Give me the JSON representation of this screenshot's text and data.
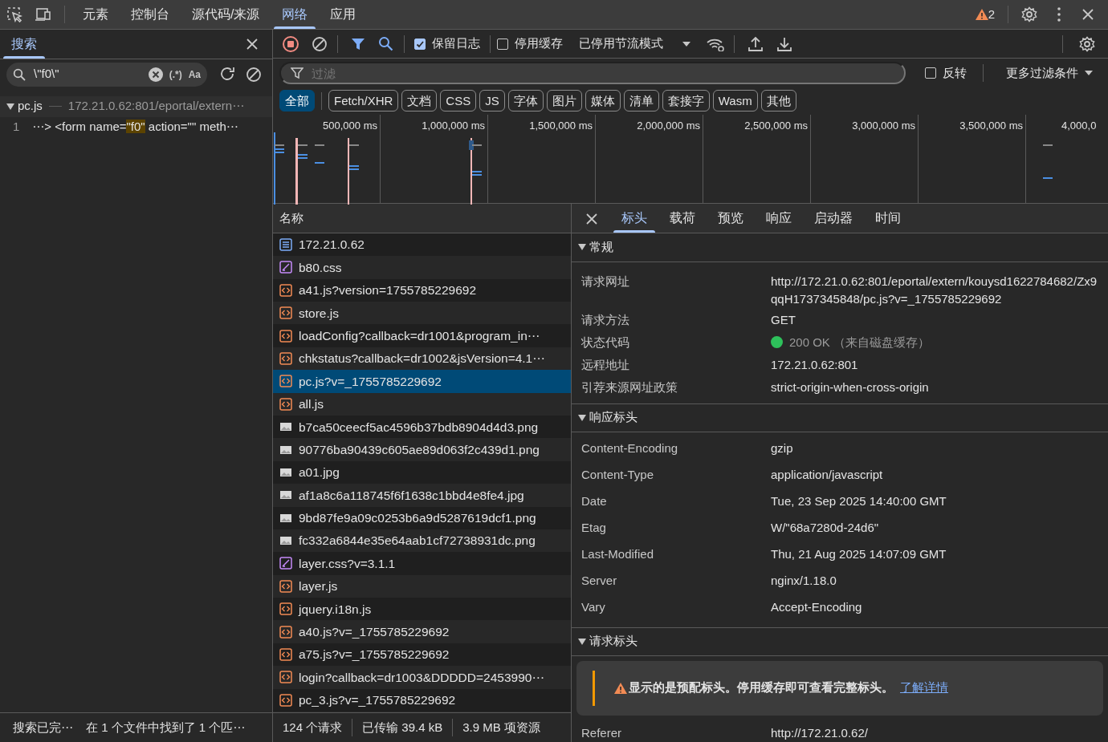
{
  "top_tabs": [
    {
      "label": "元素",
      "selected": false
    },
    {
      "label": "控制台",
      "selected": false
    },
    {
      "label": "源代码/来源",
      "selected": false
    },
    {
      "label": "网络",
      "selected": true
    },
    {
      "label": "应用",
      "selected": false
    }
  ],
  "issues_count": "2",
  "search_panel": {
    "tab": "搜索",
    "query": "\\\"f0\\\"",
    "regex_toggle": "(.*)",
    "case_toggle": "Aa",
    "results": [
      {
        "file": "pc.js",
        "path": "172.21.0.62:801/eportal/extern⋯",
        "expanded": true,
        "matches": [
          {
            "line": "1",
            "before": "⋯> <form name=",
            "match": "\"f0\"",
            "after": " action=\"\" meth⋯"
          }
        ]
      }
    ],
    "status": [
      "搜索已完⋯",
      "在 1 个文件中找到了 1 个匹⋯"
    ]
  },
  "network_toolbar": {
    "preserve_log": {
      "label": "保留日志",
      "checked": true
    },
    "disable_cache": {
      "label": "停用缓存",
      "checked": false
    },
    "throttling": "已停用节流模式"
  },
  "filter": {
    "placeholder": "过滤",
    "invert": {
      "label": "反转",
      "checked": false
    },
    "more_filters": "更多过滤条件"
  },
  "type_filters": [
    {
      "label": "全部",
      "selected": true
    },
    {
      "label": "Fetch/XHR",
      "selected": false
    },
    {
      "label": "文档",
      "selected": false
    },
    {
      "label": "CSS",
      "selected": false
    },
    {
      "label": "JS",
      "selected": false
    },
    {
      "label": "字体",
      "selected": false
    },
    {
      "label": "图片",
      "selected": false
    },
    {
      "label": "媒体",
      "selected": false
    },
    {
      "label": "清单",
      "selected": false
    },
    {
      "label": "套接字",
      "selected": false
    },
    {
      "label": "Wasm",
      "selected": false
    },
    {
      "label": "其他",
      "selected": false
    }
  ],
  "overview": {
    "ticks": [
      "500,000 ms",
      "1,000,000 ms",
      "1,500,000 ms",
      "2,000,000 ms",
      "2,500,000 ms",
      "3,000,000 ms",
      "3,500,000 ms",
      "4,000,0"
    ]
  },
  "requests": {
    "column": "名称",
    "rows": [
      {
        "name": "172.21.0.62",
        "kind": "doc",
        "selected": false
      },
      {
        "name": "b80.css",
        "kind": "css",
        "selected": false
      },
      {
        "name": "a41.js?version=1755785229692",
        "kind": "js",
        "selected": false
      },
      {
        "name": "store.js",
        "kind": "js",
        "selected": false
      },
      {
        "name": "loadConfig?callback=dr1001&program_in⋯",
        "kind": "js",
        "selected": false
      },
      {
        "name": "chkstatus?callback=dr1002&jsVersion=4.1⋯",
        "kind": "js",
        "selected": false
      },
      {
        "name": "pc.js?v=_1755785229692",
        "kind": "js",
        "selected": true
      },
      {
        "name": "all.js",
        "kind": "js",
        "selected": false
      },
      {
        "name": "b7ca50ceecf5ac4596b37bdb8904d4d3.png",
        "kind": "image",
        "selected": false
      },
      {
        "name": "90776ba90439c605ae89d063f2c439d1.png",
        "kind": "image",
        "selected": false
      },
      {
        "name": "a01.jpg",
        "kind": "image",
        "selected": false
      },
      {
        "name": "af1a8c6a118745f6f1638c1bbd4e8fe4.jpg",
        "kind": "image",
        "selected": false
      },
      {
        "name": "9bd87fe9a09c0253b6a9d5287619dcf1.png",
        "kind": "image",
        "selected": false
      },
      {
        "name": "fc332a6844e35e64aab1cf72738931dc.png",
        "kind": "image",
        "selected": false
      },
      {
        "name": "layer.css?v=3.1.1",
        "kind": "css",
        "selected": false
      },
      {
        "name": "layer.js",
        "kind": "js",
        "selected": false
      },
      {
        "name": "jquery.i18n.js",
        "kind": "js",
        "selected": false
      },
      {
        "name": "a40.js?v=_1755785229692",
        "kind": "js",
        "selected": false
      },
      {
        "name": "a75.js?v=_1755785229692",
        "kind": "js",
        "selected": false
      },
      {
        "name": "login?callback=dr1003&DDDDD=2453990⋯",
        "kind": "js",
        "selected": false
      },
      {
        "name": "pc_3.js?v=_1755785229692",
        "kind": "js",
        "selected": false
      }
    ],
    "summary": [
      "124 个请求",
      "已传输 39.4 kB",
      "3.9 MB 项资源"
    ]
  },
  "details": {
    "tabs": [
      {
        "label": "标头",
        "selected": true
      },
      {
        "label": "载荷",
        "selected": false
      },
      {
        "label": "预览",
        "selected": false
      },
      {
        "label": "响应",
        "selected": false
      },
      {
        "label": "启动器",
        "selected": false
      },
      {
        "label": "时间",
        "selected": false
      }
    ],
    "sections": [
      {
        "title": "常规",
        "expanded": true,
        "rows": [
          {
            "key": "请求网址",
            "value": "http://172.21.0.62:801/eportal/extern/kouysd1622784682/Zx9qqH1737345848/pc.js?v=_1755785229692",
            "kind": "text"
          },
          {
            "key": "请求方法",
            "value": "GET",
            "kind": "text"
          },
          {
            "key": "状态代码",
            "value": "200 OK （来自磁盘缓存）",
            "kind": "status"
          },
          {
            "key": "远程地址",
            "value": "172.21.0.62:801",
            "kind": "text"
          },
          {
            "key": "引荐来源网址政策",
            "value": "strict-origin-when-cross-origin",
            "kind": "text"
          }
        ]
      },
      {
        "title": "响应标头",
        "expanded": true,
        "rows": [
          {
            "key": "Content-Encoding",
            "value": "gzip",
            "kind": "text"
          },
          {
            "key": "Content-Type",
            "value": "application/javascript",
            "kind": "text"
          },
          {
            "key": "Date",
            "value": "Tue, 23 Sep 2025 14:40:00 GMT",
            "kind": "text"
          },
          {
            "key": "Etag",
            "value": "W/\"68a7280d-24d6\"",
            "kind": "text"
          },
          {
            "key": "Last-Modified",
            "value": "Thu, 21 Aug 2025 14:07:09 GMT",
            "kind": "text"
          },
          {
            "key": "Server",
            "value": "nginx/1.18.0",
            "kind": "text"
          },
          {
            "key": "Vary",
            "value": "Accept-Encoding",
            "kind": "text"
          }
        ]
      },
      {
        "title": "请求标头",
        "expanded": true,
        "warning": {
          "text": "显示的是预配标头。停用缓存即可查看完整标头。",
          "link": "了解详情"
        },
        "rows": [
          {
            "key": "Referer",
            "value": "http://172.21.0.62/",
            "kind": "text"
          }
        ]
      }
    ]
  }
}
